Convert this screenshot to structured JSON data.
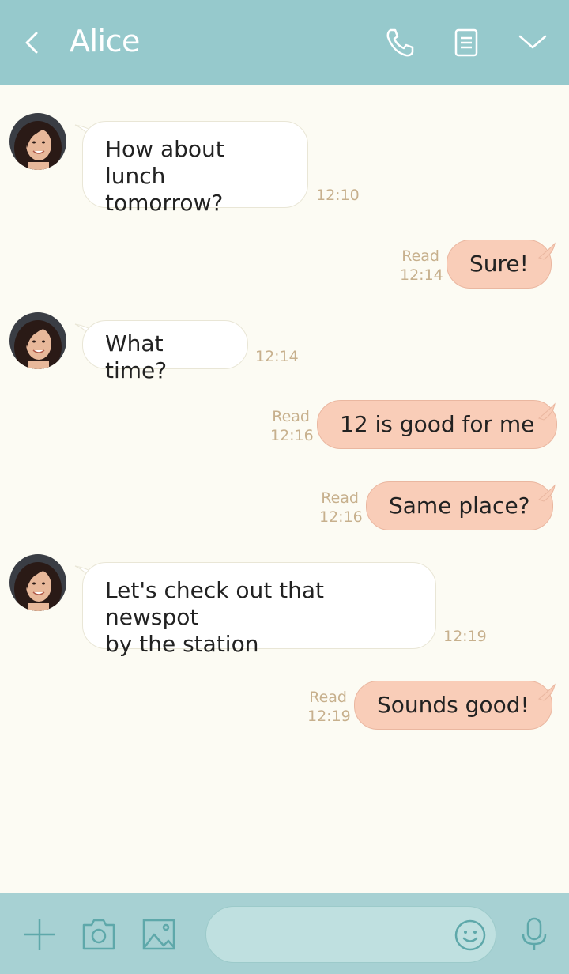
{
  "header": {
    "title": "Alice",
    "icons": [
      "back-arrow-icon",
      "phone-icon",
      "notes-icon",
      "chevron-down-icon"
    ]
  },
  "messages": [
    {
      "from": "Alice",
      "direction": "incoming",
      "text_lines": [
        "How about lunch",
        "tomorrow?"
      ],
      "time": "12:10"
    },
    {
      "direction": "outgoing",
      "text": "Sure!",
      "read": "Read",
      "time": "12:14"
    },
    {
      "from": "Alice",
      "direction": "incoming",
      "text_lines": [
        "What time?"
      ],
      "time": "12:14"
    },
    {
      "direction": "outgoing",
      "text": "12 is good for me",
      "read": "Read",
      "time": "12:16"
    },
    {
      "direction": "outgoing",
      "text": "Same place?",
      "read": "Read",
      "time": "12:16"
    },
    {
      "from": "Alice",
      "direction": "incoming",
      "text_lines": [
        "Let's check out that newspot",
        "by the station"
      ],
      "time": "12:19"
    },
    {
      "direction": "outgoing",
      "text": "Sounds good!",
      "read": "Read",
      "time": "12:19"
    }
  ],
  "bottom_bar": {
    "input_placeholder": "",
    "icons": [
      "plus-icon",
      "camera-icon",
      "image-icon",
      "emoji-icon",
      "microphone-icon"
    ]
  },
  "colors": {
    "header": "#96c9cc",
    "background": "#fcfbf3",
    "bubble_incoming": "#ffffff",
    "bubble_outgoing": "#f9cdb8",
    "meta_text": "#c7b08d",
    "bottom_bar": "#a7d1d3"
  }
}
